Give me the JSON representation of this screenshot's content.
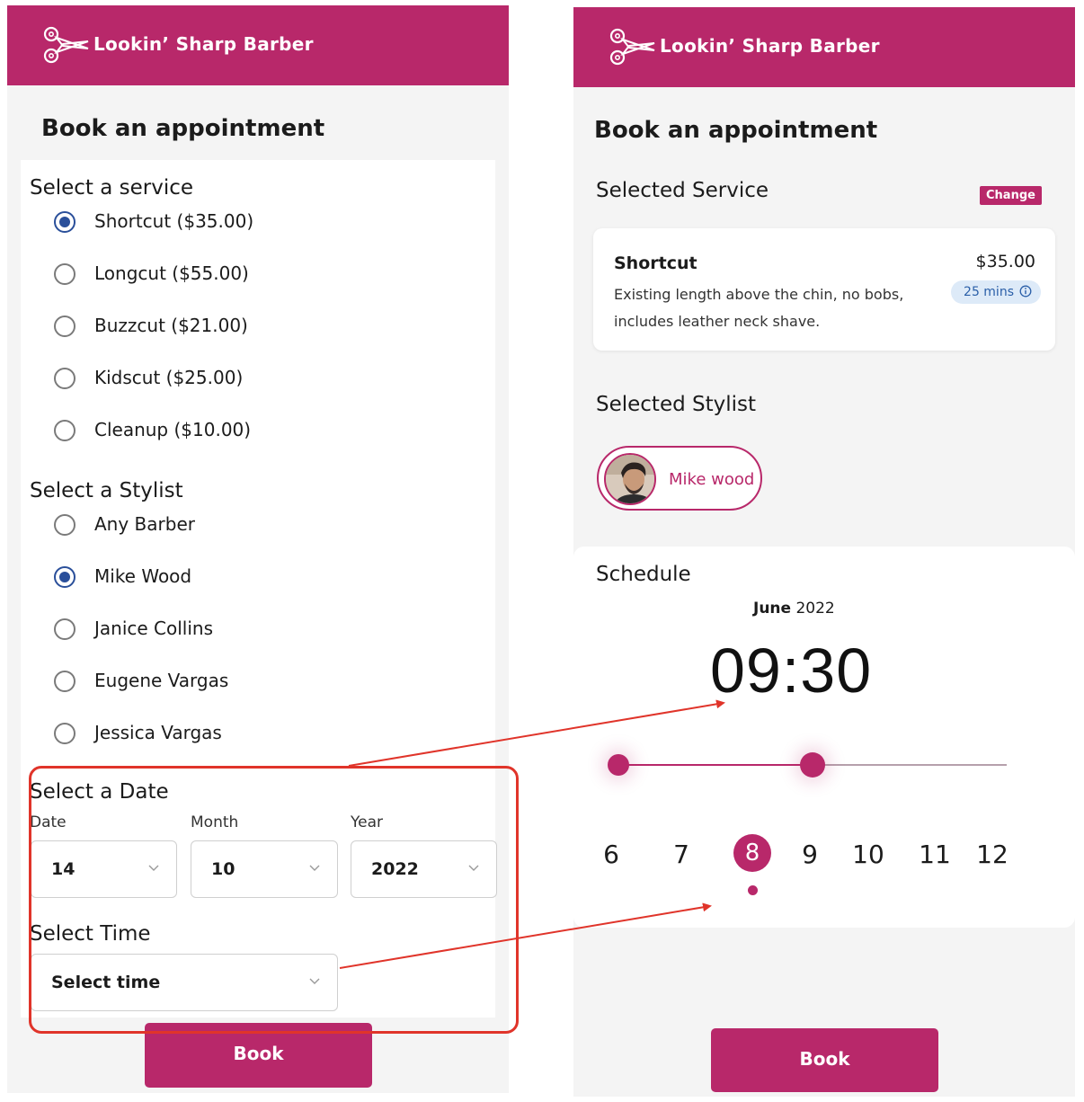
{
  "brand": {
    "name": "Lookin’ Sharp Barber",
    "icon": "scissors-icon"
  },
  "left": {
    "title": "Book an appointment",
    "service_section": {
      "label": "Select a service",
      "options": [
        {
          "label": "Shortcut ($35.00)",
          "checked": true
        },
        {
          "label": "Longcut ($55.00)",
          "checked": false
        },
        {
          "label": "Buzzcut ($21.00)",
          "checked": false
        },
        {
          "label": "Kidscut ($25.00)",
          "checked": false
        },
        {
          "label": "Cleanup ($10.00)",
          "checked": false
        }
      ]
    },
    "stylist_section": {
      "label": "Select a Stylist",
      "options": [
        {
          "label": "Any Barber",
          "checked": false
        },
        {
          "label": "Mike Wood",
          "checked": true
        },
        {
          "label": "Janice Collins",
          "checked": false
        },
        {
          "label": "Eugene Vargas",
          "checked": false
        },
        {
          "label": "Jessica Vargas",
          "checked": false
        }
      ]
    },
    "date_section": {
      "label": "Select a Date",
      "date_label": "Date",
      "date_value": "14",
      "month_label": "Month",
      "month_value": "10",
      "year_label": "Year",
      "year_value": "2022"
    },
    "time_section": {
      "label": "Select Time",
      "value": "Select time"
    },
    "book_label": "Book"
  },
  "right": {
    "title": "Book an appointment",
    "selected_service_label": "Selected Service",
    "change_label": "Change",
    "service": {
      "name": "Shortcut",
      "description": "Existing length above the chin, no bobs, includes leather neck shave.",
      "price": "$35.00",
      "duration": "25 mins"
    },
    "selected_stylist_label": "Selected Stylist",
    "stylist": {
      "name": "Mike wood"
    },
    "schedule": {
      "label": "Schedule",
      "month": "June",
      "year": "2022",
      "time": "09:30",
      "slider_level": 0.5,
      "days": [
        "6",
        "7",
        "8",
        "9",
        "10",
        "11",
        "12"
      ],
      "selected_day": "8"
    },
    "book_label": "Book"
  },
  "colors": {
    "brand": "#b8286a",
    "radio_checked": "#2a4f9a",
    "annotation": "#e0342a",
    "duration_pill_bg": "#ddeaf8"
  }
}
